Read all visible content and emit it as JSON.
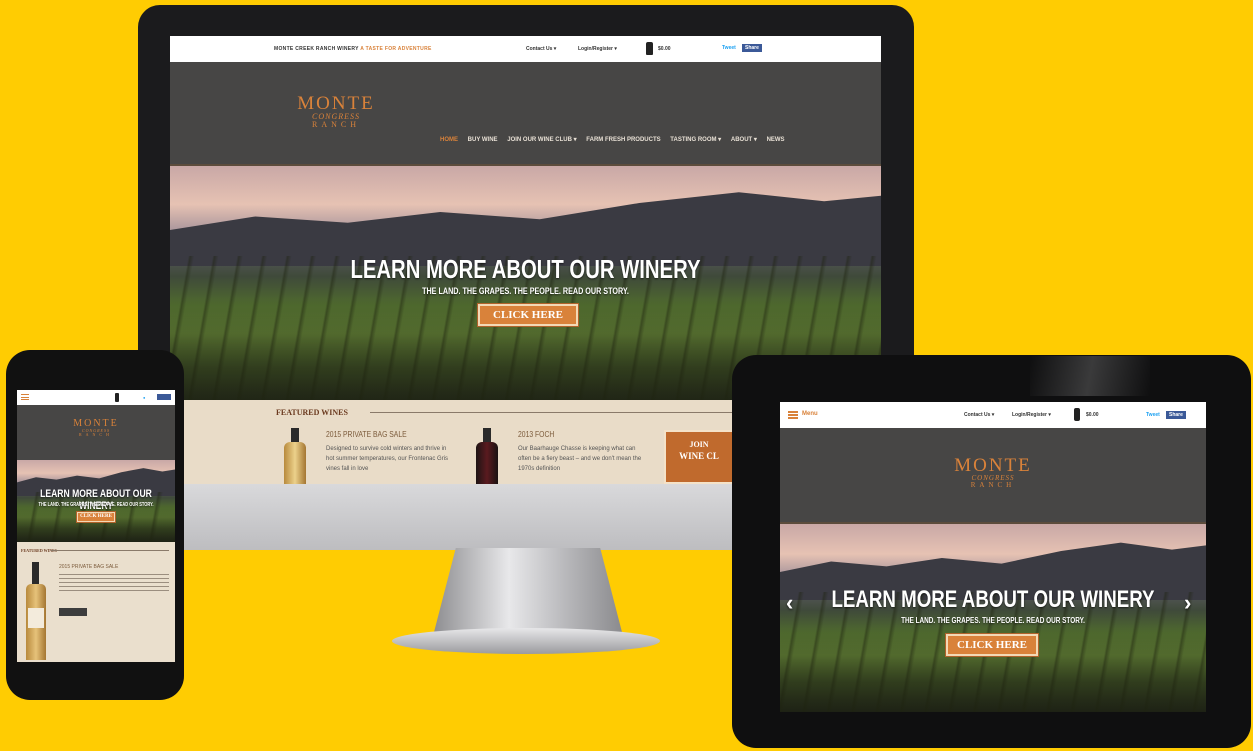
{
  "colors": {
    "background": "#ffcc02",
    "accent": "#d9823a",
    "header": "#474645",
    "featured_bg": "#e9dcc8",
    "facebook": "#3b5998",
    "twitter": "#1da1f2"
  },
  "brand": {
    "line1": "MONTE",
    "line2": "CONGRESS",
    "line3": "RANCH"
  },
  "desktop": {
    "tagline_prefix": "MONTE CREEK RANCH WINERY",
    "tagline_highlight": "A TASTE FOR ADVENTURE",
    "topbar": {
      "contact": "Contact Us ▾",
      "login": "Login/Register ▾",
      "cart": "$0.00",
      "tweet": "Tweet",
      "share": "Share"
    },
    "nav": [
      "HOME",
      "BUY WINE",
      "JOIN OUR WINE CLUB ▾",
      "FARM FRESH PRODUCTS",
      "TASTING ROOM ▾",
      "ABOUT ▾",
      "NEWS"
    ],
    "hero": {
      "title": "LEARN MORE ABOUT OUR WINERY",
      "subtitle": "THE LAND. THE GRAPES. THE PEOPLE. READ OUR STORY.",
      "cta": "CLICK HERE"
    },
    "featured": {
      "title": "FEATURED WINES",
      "wines": [
        {
          "name": "2015 PRIVATE BAG SALE",
          "desc": "Designed to survive cold winters and thrive in hot summer temperatures, our Frontenac Gris vines fall in love"
        },
        {
          "name": "2013 FOCH",
          "desc": "Our Baarhauge Chasse is keeping what can often be a fiery beast – and we don't mean the 1970s definition"
        }
      ],
      "club_line1": "JOIN",
      "club_line2": "WINE CL"
    }
  },
  "phone": {
    "hero_title": "LEARN MORE ABOUT OUR WINERY",
    "hero_subtitle": "THE LAND. THE GRAPES. THE PEOPLE. READ OUR STORY.",
    "cta": "CLICK HERE",
    "featured_title": "FEATURED WINES",
    "wine_name": "2015 PRIVATE BAG SALE"
  },
  "tablet": {
    "menu": "Menu",
    "contact": "Contact Us ▾",
    "login": "Login/Register ▾",
    "cart": "$0.00",
    "tweet": "Tweet",
    "share": "Share",
    "hero_title": "LEARN MORE ABOUT OUR WINERY",
    "hero_subtitle": "THE LAND. THE GRAPES. THE PEOPLE. READ OUR STORY.",
    "cta": "CLICK HERE",
    "prev": "‹",
    "next": "›"
  }
}
